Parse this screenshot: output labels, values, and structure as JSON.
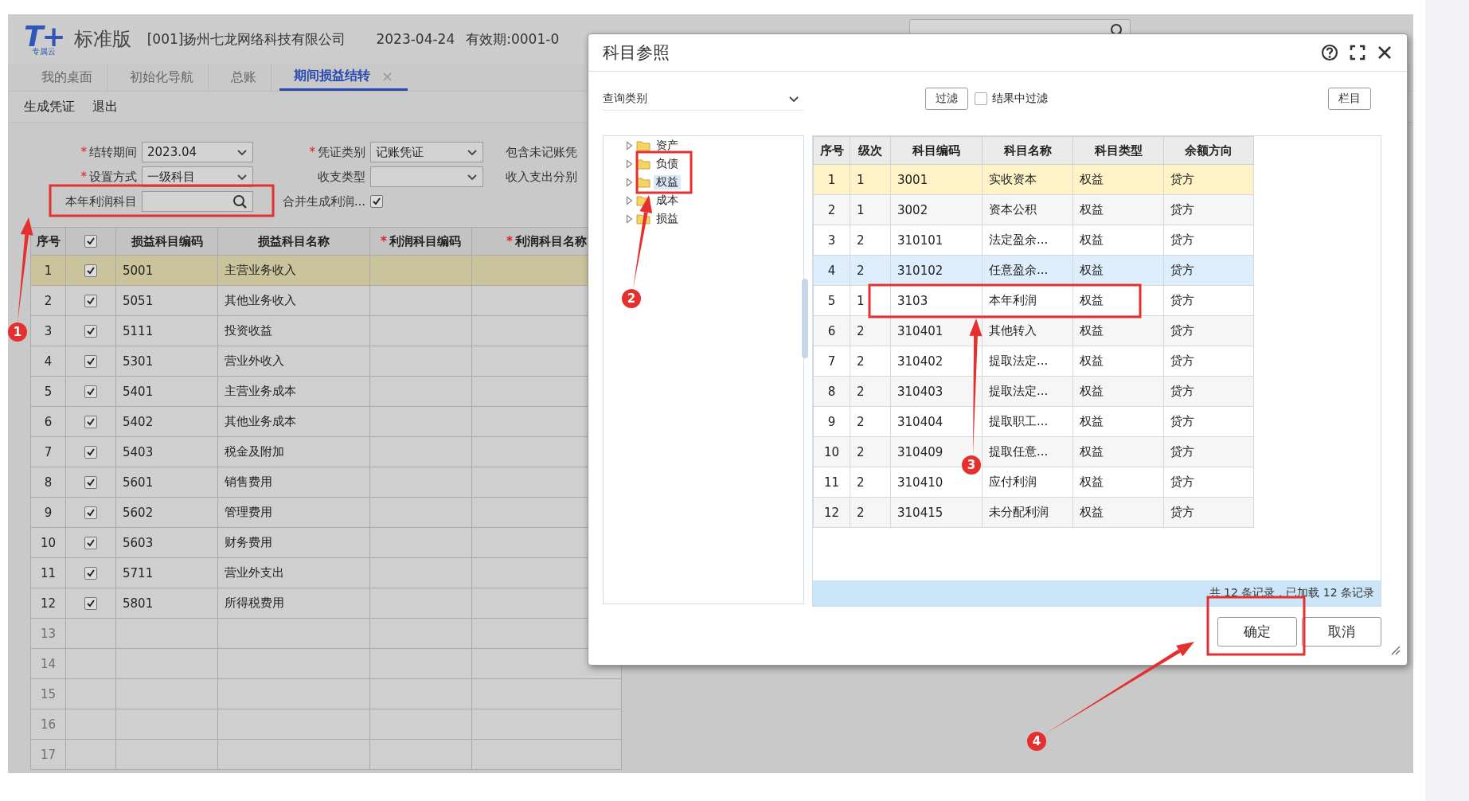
{
  "header": {
    "logo": "T+",
    "logo_sub": "专属云",
    "edition": "标准版",
    "company": "[001]扬州七龙网络科技有限公司",
    "date": "2023-04-24",
    "validity": "有效期:0001-0"
  },
  "tabs": [
    {
      "label": "我的桌面",
      "selected": false
    },
    {
      "label": "初始化导航",
      "selected": false
    },
    {
      "label": "总账",
      "selected": false
    },
    {
      "label": "期间损益结转",
      "selected": true,
      "close": "×"
    }
  ],
  "toolbar": [
    "生成凭证",
    "退出"
  ],
  "form": [
    {
      "kind": "select",
      "label": "结转期间",
      "required_mark": "*",
      "value": "2023.04"
    },
    {
      "kind": "select",
      "label": "凭证类别",
      "required_mark": "*",
      "value": "记账凭证"
    },
    {
      "kind": "note",
      "label": "包含未记账凭"
    },
    {
      "kind": "select",
      "label": "设置方式",
      "required_mark": "*",
      "value": "一级科目"
    },
    {
      "kind": "select",
      "label": "收支类型"
    },
    {
      "kind": "note",
      "label": "收入支出分别"
    },
    {
      "kind": "lookup",
      "label": "本年利润科目"
    },
    {
      "kind": "checkbox",
      "label": "合并生成利润...",
      "checked": true
    }
  ],
  "table": {
    "header_checked": true,
    "columns": [
      {
        "label": "序号"
      },
      {
        "kind": "check"
      },
      {
        "label": "损益科目编码"
      },
      {
        "label": "损益科目名称"
      },
      {
        "label": "利润科目编码",
        "required_mark": "*"
      },
      {
        "label": "利润科目名称",
        "required_mark": "*"
      }
    ],
    "rows": [
      {
        "kind": "entry",
        "no": "1",
        "checked": true,
        "code": "5001",
        "name": "主营业务收入",
        "selected": true
      },
      {
        "kind": "entry",
        "no": "2",
        "checked": true,
        "code": "5051",
        "name": "其他业务收入",
        "selected": false
      },
      {
        "kind": "entry",
        "no": "3",
        "checked": true,
        "code": "5111",
        "name": "投资收益",
        "selected": false
      },
      {
        "kind": "entry",
        "no": "4",
        "checked": true,
        "code": "5301",
        "name": "营业外收入",
        "selected": false
      },
      {
        "kind": "entry",
        "no": "5",
        "checked": true,
        "code": "5401",
        "name": "主营业务成本",
        "selected": false
      },
      {
        "kind": "entry",
        "no": "6",
        "checked": true,
        "code": "5402",
        "name": "其他业务成本",
        "selected": false
      },
      {
        "kind": "entry",
        "no": "7",
        "checked": true,
        "code": "5403",
        "name": "税金及附加",
        "selected": false
      },
      {
        "kind": "entry",
        "no": "8",
        "checked": true,
        "code": "5601",
        "name": "销售费用",
        "selected": false
      },
      {
        "kind": "entry",
        "no": "9",
        "checked": true,
        "code": "5602",
        "name": "管理费用",
        "selected": false
      },
      {
        "kind": "entry",
        "no": "10",
        "checked": true,
        "code": "5603",
        "name": "财务费用",
        "selected": false
      },
      {
        "kind": "entry",
        "no": "11",
        "checked": true,
        "code": "5711",
        "name": "营业外支出",
        "selected": false
      },
      {
        "kind": "entry",
        "no": "12",
        "checked": true,
        "code": "5801",
        "name": "所得税费用",
        "selected": false
      },
      {
        "kind": "empty",
        "no": "13"
      },
      {
        "kind": "empty",
        "no": "14"
      },
      {
        "kind": "empty",
        "no": "15"
      },
      {
        "kind": "empty",
        "no": "16"
      },
      {
        "kind": "empty",
        "no": "17"
      }
    ]
  },
  "dialog": {
    "title": "科目参照",
    "query_select": "查询类别",
    "filter_button": "过滤",
    "filter_in_results": {
      "label": "结果中过滤",
      "checked": false
    },
    "columns_button": "栏目",
    "tree": [
      {
        "label": "资产",
        "selected": false
      },
      {
        "label": "负债",
        "selected": false
      },
      {
        "label": "权益",
        "selected": true
      },
      {
        "label": "成本",
        "selected": false
      },
      {
        "label": "损益",
        "selected": false
      }
    ],
    "columns": [
      "序号",
      "级次",
      "科目编码",
      "科目名称",
      "科目类型",
      "余额方向"
    ],
    "rows": [
      {
        "no": "1",
        "grade": "1",
        "code": "3001",
        "name": "实收资本",
        "type": "权益",
        "direction": "贷方",
        "selected": true,
        "hovered": false
      },
      {
        "no": "2",
        "grade": "1",
        "code": "3002",
        "name": "资本公积",
        "type": "权益",
        "direction": "贷方",
        "selected": false,
        "hovered": false
      },
      {
        "no": "3",
        "grade": "2",
        "code": "310101",
        "name": "法定盈余...",
        "type": "权益",
        "direction": "贷方",
        "selected": false,
        "hovered": false
      },
      {
        "no": "4",
        "grade": "2",
        "code": "310102",
        "name": "任意盈余...",
        "type": "权益",
        "direction": "贷方",
        "selected": false,
        "hovered": true
      },
      {
        "no": "5",
        "grade": "1",
        "code": "3103",
        "name": "本年利润",
        "type": "权益",
        "direction": "贷方",
        "selected": false,
        "hovered": false
      },
      {
        "no": "6",
        "grade": "2",
        "code": "310401",
        "name": "其他转入",
        "type": "权益",
        "direction": "贷方",
        "selected": false,
        "hovered": false
      },
      {
        "no": "7",
        "grade": "2",
        "code": "310402",
        "name": "提取法定...",
        "type": "权益",
        "direction": "贷方",
        "selected": false,
        "hovered": false
      },
      {
        "no": "8",
        "grade": "2",
        "code": "310403",
        "name": "提取法定...",
        "type": "权益",
        "direction": "贷方",
        "selected": false,
        "hovered": false
      },
      {
        "no": "9",
        "grade": "2",
        "code": "310404",
        "name": "提取职工...",
        "type": "权益",
        "direction": "贷方",
        "selected": false,
        "hovered": false
      },
      {
        "no": "10",
        "grade": "2",
        "code": "310409",
        "name": "提取任意...",
        "type": "权益",
        "direction": "贷方",
        "selected": false,
        "hovered": false
      },
      {
        "no": "11",
        "grade": "2",
        "code": "310410",
        "name": "应付利润",
        "type": "权益",
        "direction": "贷方",
        "selected": false,
        "hovered": false
      },
      {
        "no": "12",
        "grade": "2",
        "code": "310415",
        "name": "未分配利润",
        "type": "权益",
        "direction": "贷方",
        "selected": false,
        "hovered": false
      }
    ],
    "status": "共 12 条记录，已加载 12 条记录",
    "buttons": [
      "确定",
      "取消"
    ]
  },
  "annotations": [
    {
      "number": "1"
    },
    {
      "number": "2"
    },
    {
      "number": "3"
    },
    {
      "number": "4"
    }
  ]
}
